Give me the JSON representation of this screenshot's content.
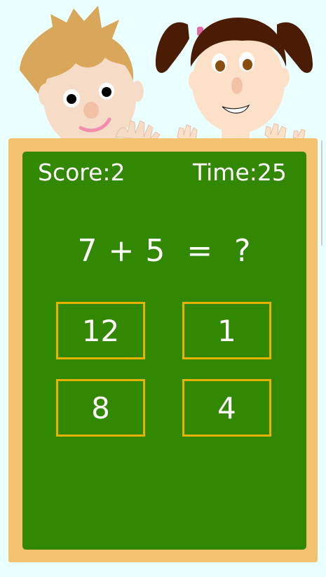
{
  "colors": {
    "background": "#eaffff",
    "frame": "#f2c26f",
    "board": "#338803",
    "answer_border": "#e7b200",
    "text": "#ffffff"
  },
  "hud": {
    "score_text": "Score:2",
    "time_text": "Time:25"
  },
  "question": {
    "text": "7 + 5  =  ?"
  },
  "answers": [
    {
      "label": "12"
    },
    {
      "label": "1"
    },
    {
      "label": "8"
    },
    {
      "label": "4"
    }
  ],
  "illustrations": {
    "boy": "boy-character",
    "girl": "girl-character"
  }
}
